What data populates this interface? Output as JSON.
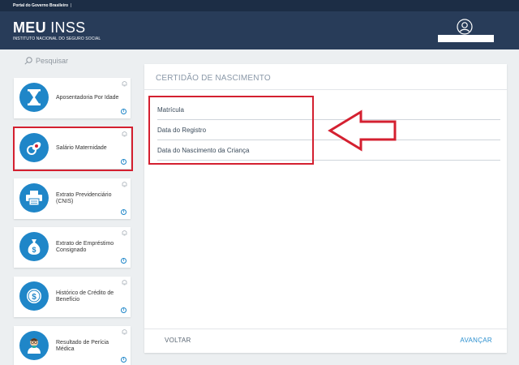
{
  "gov_bar": {
    "text": "Portal do Governo Brasileiro",
    "separator": "|"
  },
  "header": {
    "brand_bold": "MEU",
    "brand_rest": "INSS",
    "subtitle": "INSTITUTO NACIONAL DO SEGURO SOCIAL"
  },
  "search": {
    "placeholder": "Pesquisar",
    "icon": "search-icon"
  },
  "services": [
    {
      "label": "Aposentadoria Por Idade",
      "icon": "hourglass-icon"
    },
    {
      "label": "Salário Maternidade",
      "icon": "baby-pacifier-icon"
    },
    {
      "label": "Extrato Previdenciário (CNIS)",
      "icon": "printer-icon"
    },
    {
      "label": "Extrato de Empréstimo Consignado",
      "icon": "money-bag-icon"
    },
    {
      "label": "Histórico de Crédito de Benefício",
      "icon": "coin-icon"
    },
    {
      "label": "Resultado de Perícia Médica",
      "icon": "doctor-icon"
    }
  ],
  "panel": {
    "title": "CERTIDÃO DE NASCIMENTO",
    "fields": [
      "Matrícula",
      "Data do Registro",
      "Data do Nascimento da Criança"
    ],
    "back_label": "VOLTAR",
    "next_label": "AVANÇAR"
  },
  "colors": {
    "header": "#283c59",
    "gov_bar": "#1c2d45",
    "accent": "#1f86c8",
    "highlight": "#d42030",
    "link": "#2b8fcf"
  }
}
